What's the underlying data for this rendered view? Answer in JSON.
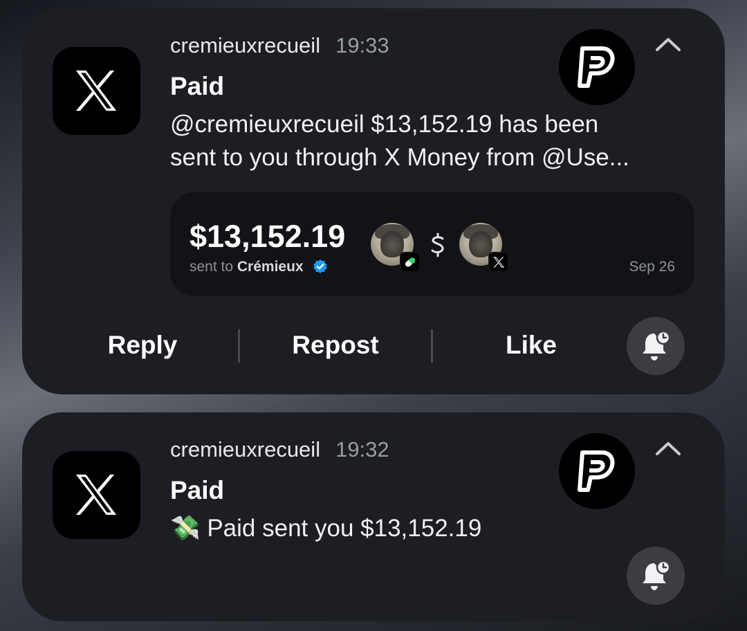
{
  "notifications": [
    {
      "app_icon": "x-logo-icon",
      "sender": "cremieuxrecueil",
      "time": "19:33",
      "title": "Paid",
      "body_line1": "@cremieuxrecueil $13,152.19 has been",
      "body_line2": "sent to you through X Money from @Use...",
      "badge_icon": "paid-p-logo-icon",
      "payment": {
        "amount": "$13,152.19",
        "sent_to_label": "sent to",
        "recipient": "Crémieux",
        "date": "Sep 26"
      },
      "actions": {
        "reply": "Reply",
        "repost": "Repost",
        "like": "Like"
      }
    },
    {
      "app_icon": "x-logo-icon",
      "sender": "cremieuxrecueil",
      "time": "19:32",
      "title": "Paid",
      "body_emoji": "💸",
      "body": "Paid sent you $13,152.19",
      "badge_icon": "paid-p-logo-icon"
    }
  ],
  "colors": {
    "card_bg": "#1d1e23",
    "inner_card_bg": "#121316",
    "verified_blue": "#1d9bf0",
    "bell_bg": "#3b3d43"
  }
}
